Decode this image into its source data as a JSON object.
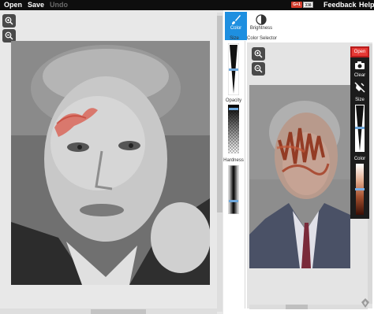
{
  "topbar": {
    "open": "Open",
    "save": "Save",
    "undo": "Undo",
    "gplus": "G+1",
    "gplus_count": "338",
    "feedback": "Feedback",
    "help": "Help"
  },
  "tabs": {
    "color": "Color",
    "brightness": "Brightness"
  },
  "tools": {
    "size": "Size",
    "opacity": "Opacity",
    "hardness": "Hardness",
    "color_selector": "Color Selector"
  },
  "reference_toolbar": {
    "open": "Open",
    "clear": "Clear",
    "size": "Size",
    "color": "Color"
  },
  "colors": {
    "accent": "#1e8fe0",
    "open_button": "#e53935",
    "topbar": "#0e0e0e"
  },
  "icons": [
    "zoom-in-icon",
    "zoom-out-icon",
    "brush-icon",
    "brightness-icon",
    "camera-icon",
    "clear-icon"
  ]
}
